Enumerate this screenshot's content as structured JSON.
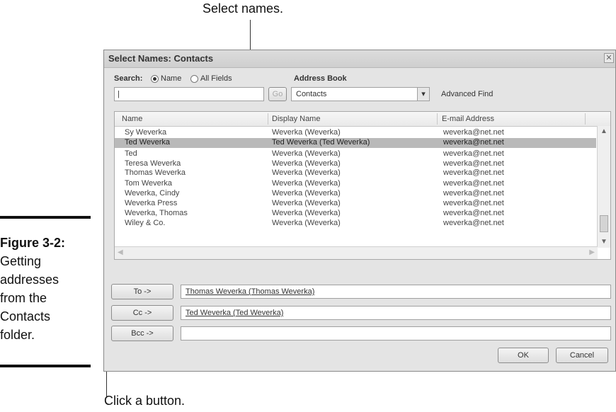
{
  "callouts": {
    "top": "Select names.",
    "bottom": "Click a button."
  },
  "caption": {
    "figure": "Figure 3-2:",
    "text": [
      "Getting",
      "addresses",
      "from the",
      "Contacts",
      "folder."
    ]
  },
  "dialog": {
    "title": "Select Names: Contacts",
    "close_glyph": "✕",
    "search_label": "Search:",
    "radio_name": "Name",
    "radio_all_fields": "All Fields",
    "search_value": "|",
    "go_label": "Go",
    "address_book_label": "Address Book",
    "address_book_value": "Contacts",
    "dropdown_glyph": "▾",
    "advanced_find": "Advanced Find",
    "columns": [
      "Name",
      "Display Name",
      "E-mail Address"
    ],
    "rows": [
      {
        "name": "Sy Weverka",
        "display": "Weverka (Weverka)",
        "email": "weverka@net.net",
        "selected": false
      },
      {
        "name": "Ted Weverka",
        "display": "Ted Weverka (Ted Weverka)",
        "email": "weverka@net.net",
        "selected": true
      },
      {
        "name": "Ted",
        "display": "Weverka (Weverka)",
        "email": "weverka@net.net",
        "selected": false
      },
      {
        "name": "Teresa Weverka",
        "display": "Weverka (Weverka)",
        "email": "weverka@net.net",
        "selected": false
      },
      {
        "name": "Thomas Weverka",
        "display": "Weverka (Weverka)",
        "email": "weverka@net.net",
        "selected": false
      },
      {
        "name": "Tom Weverka",
        "display": "Weverka (Weverka)",
        "email": "weverka@net.net",
        "selected": false
      },
      {
        "name": "Weverka, Cindy",
        "display": "Weverka (Weverka)",
        "email": "weverka@net.net",
        "selected": false
      },
      {
        "name": "Weverka Press",
        "display": "Weverka (Weverka)",
        "email": "weverka@net.net",
        "selected": false
      },
      {
        "name": "Weverka, Thomas",
        "display": "Weverka (Weverka)",
        "email": "weverka@net.net",
        "selected": false
      },
      {
        "name": "Wiley & Co.",
        "display": "Weverka (Weverka)",
        "email": "weverka@net.net",
        "selected": false
      }
    ],
    "to_label": "To ->",
    "to_value": "Thomas Weverka (Thomas Weverka)",
    "cc_label": "Cc ->",
    "cc_value": "Ted Weverka (Ted Weverka)",
    "bcc_label": "Bcc ->",
    "bcc_value": "",
    "ok_label": "OK",
    "cancel_label": "Cancel"
  }
}
